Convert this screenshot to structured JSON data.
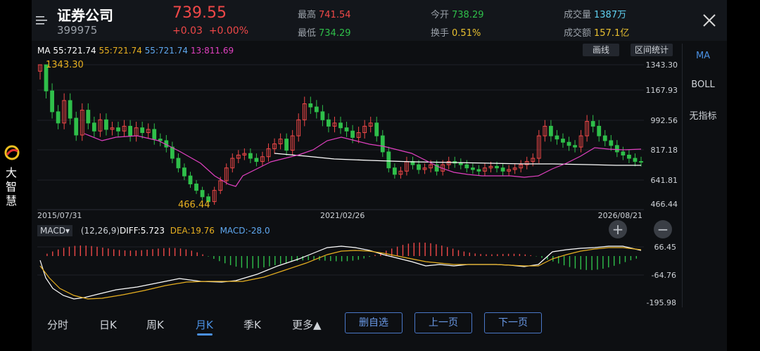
{
  "brand": {
    "text": "大智慧"
  },
  "header": {
    "name": "证券公司",
    "code": "399975",
    "price": "739.55",
    "change": "+0.03",
    "change_pct": "+0.00%",
    "high_label": "最高",
    "high": "741.54",
    "low_label": "最低",
    "low": "734.29",
    "open_label": "今开",
    "open": "738.29",
    "turnover_label": "换手",
    "turnover": "0.51%",
    "volume_label": "成交量",
    "volume": "1387万",
    "amount_label": "成交额",
    "amount": "157.1亿"
  },
  "ma": {
    "label": "MA",
    "ma1": "55:721.74",
    "ma2": "55:721.74",
    "ma3": "55:721.74",
    "ma4": "13:811.69"
  },
  "toolbar": {
    "draw": "画线",
    "range_stats": "区间统计"
  },
  "side_tabs": [
    "MA",
    "BOLL",
    "无指标"
  ],
  "price_axis": [
    "1343.30",
    "1167.93",
    "992.56",
    "817.18",
    "641.81",
    "466.44"
  ],
  "dates": {
    "start": "2015/07/31",
    "mid": "2021/02/26",
    "end": "2026/08/21"
  },
  "annotations": {
    "max": "1343.30",
    "min": "466.44"
  },
  "macd": {
    "selector": "MACD",
    "params": "(12,26,9)",
    "diff": "DIFF:5.723",
    "dea": "DEA:19.76",
    "macd": "MACD:-28.0",
    "axis": [
      "66.45",
      "-64.76",
      "-195.98"
    ]
  },
  "zoom": {
    "in": "+",
    "out": "−"
  },
  "ktabs": [
    "分时",
    "日K",
    "周K",
    "月K",
    "季K",
    "更多▲"
  ],
  "buttons": {
    "remove": "删自选",
    "prev": "上一页",
    "next": "下一页"
  },
  "colors": {
    "up": "#f04848",
    "down": "#2fbf4a",
    "accent": "#4a90e2",
    "ma_white": "#ffffff",
    "ma_pink": "#e040c0",
    "dea": "#e8b020"
  },
  "chart_data": {
    "type": "candlestick",
    "ylim": [
      466.44,
      1343.3
    ],
    "closes": [
      1343,
      1180,
      1050,
      980,
      1120,
      1010,
      905,
      1060,
      980,
      930,
      1000,
      940,
      950,
      930,
      960,
      900,
      950,
      920,
      940,
      880,
      870,
      830,
      760,
      700,
      650,
      600,
      560,
      520,
      490,
      560,
      620,
      700,
      760,
      780,
      790,
      760,
      740,
      770,
      820,
      850,
      880,
      810,
      900,
      1000,
      1100,
      1080,
      1050,
      1000,
      960,
      980,
      950,
      930,
      890,
      920,
      960,
      980,
      900,
      800,
      700,
      660,
      680,
      740,
      720,
      690,
      700,
      720,
      680,
      720,
      740,
      730,
      720,
      700,
      690,
      680,
      700,
      710,
      700,
      680,
      690,
      700,
      720,
      740,
      760,
      900,
      960,
      900,
      880,
      860,
      840,
      830,
      900,
      990,
      960,
      900,
      870,
      840,
      800,
      780,
      760,
      740,
      739
    ]
  }
}
